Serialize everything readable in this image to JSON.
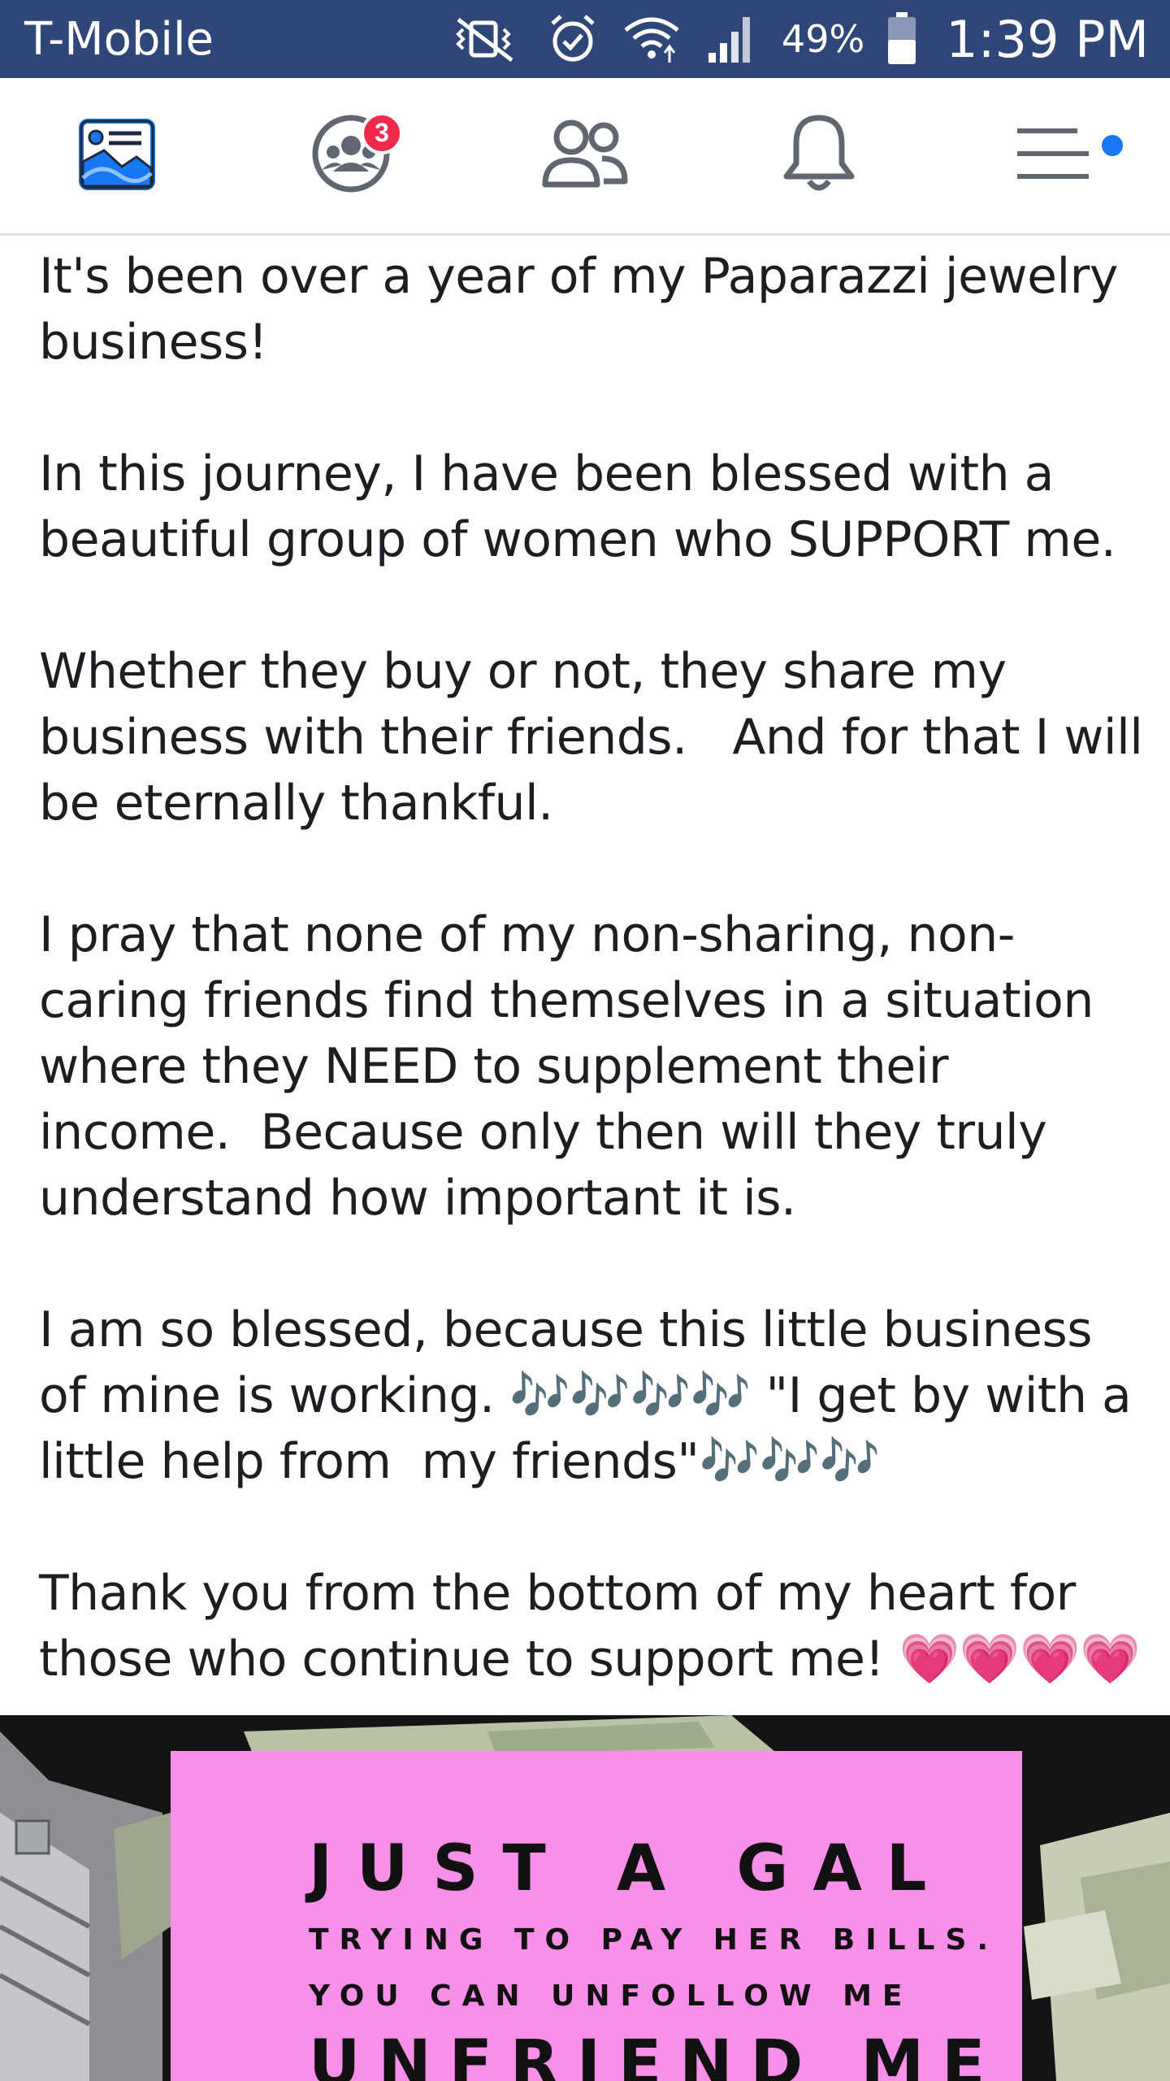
{
  "status_bar": {
    "carrier": "T-Mobile",
    "battery": "49%",
    "time": "1:39 PM",
    "icons": [
      "vibrate-off-icon",
      "alarm-icon",
      "wifi-icon",
      "signal-icon",
      "battery-icon"
    ]
  },
  "nav": {
    "tabs": [
      {
        "name": "news-feed",
        "icon": "news-feed-icon"
      },
      {
        "name": "groups",
        "icon": "groups-icon",
        "badge": "3"
      },
      {
        "name": "friends",
        "icon": "friends-icon"
      },
      {
        "name": "notifications",
        "icon": "bell-icon"
      },
      {
        "name": "menu",
        "icon": "menu-icon"
      }
    ],
    "active_color": "#1877f2",
    "badge_color": "#f02849"
  },
  "post": {
    "paragraphs": [
      "It's been over a year of my Paparazzi jewelry business!",
      "In this journey, I have been blessed with a beautiful group of women who SUPPORT me.",
      "Whether they buy or not, they share my business with their friends.   And for that I will be eternally thankful.",
      "I pray that none of my non-sharing, non-caring friends find themselves in a situation where they NEED to supplement their income.  Because only then will they truly understand how important it is.",
      "I am so blessed, because this little business of mine is working. 🎶🎶🎶🎶 \"I get by with a little help from  my friends\"🎶🎶🎶",
      "Thank you from the bottom of my heart for those who continue to support me! 💗💗💗💗"
    ]
  },
  "image": {
    "line1": "JUST A GAL",
    "line2": "TRYING TO PAY HER BILLS.",
    "line3": "YOU CAN UNFOLLOW ME",
    "line4": "UNFRIEND ME",
    "card_color": "#f98fe8"
  }
}
